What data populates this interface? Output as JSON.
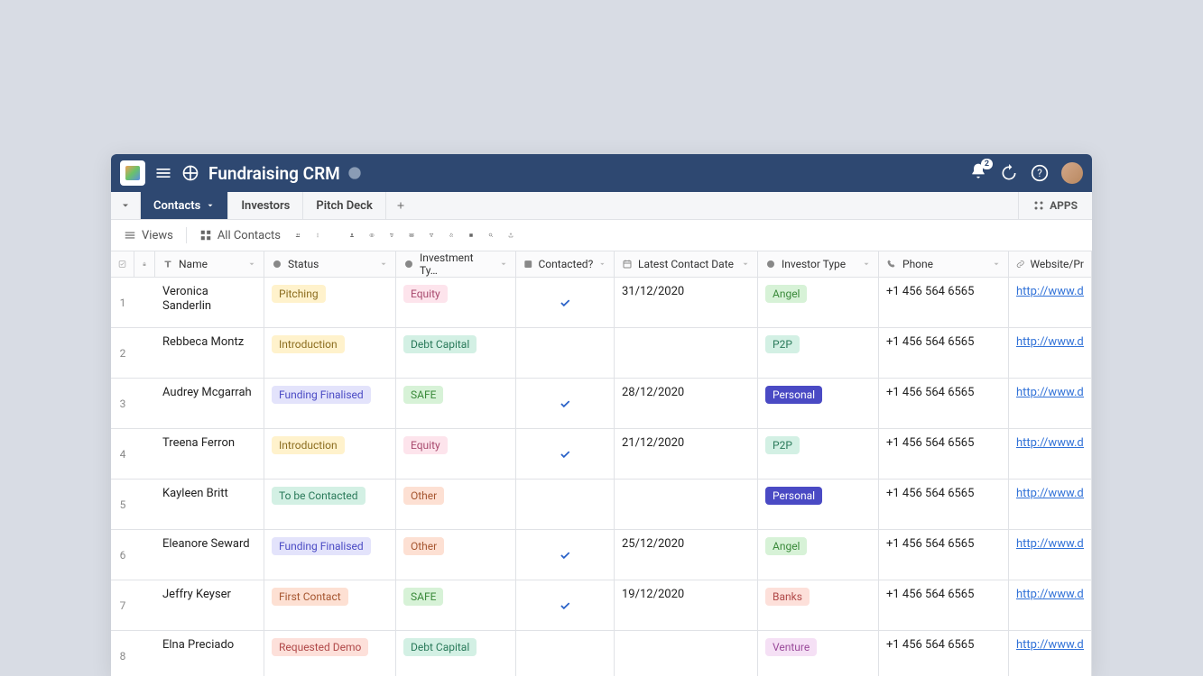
{
  "header": {
    "title": "Fundraising CRM",
    "bell_badge": "2"
  },
  "tabs": [
    {
      "label": "Contacts",
      "active": true,
      "has_dropdown": true
    },
    {
      "label": "Investors",
      "active": false
    },
    {
      "label": "Pitch Deck",
      "active": false
    }
  ],
  "apps_label": "APPS",
  "toolbar": {
    "views_label": "Views",
    "current_view": "All Contacts"
  },
  "columns": {
    "name": "Name",
    "status": "Status",
    "investment_type": "Investment Ty…",
    "contacted": "Contacted?",
    "latest_contact_date": "Latest Contact Date",
    "investor_type": "Investor Type",
    "phone": "Phone",
    "website": "Website/Pr"
  },
  "status_colors": {
    "Pitching": {
      "bg": "#fff2cc",
      "fg": "#8b6d1f"
    },
    "Introduction": {
      "bg": "#fff2cc",
      "fg": "#8b6d1f"
    },
    "Funding Finalised": {
      "bg": "#e3e3fb",
      "fg": "#4a4ac4"
    },
    "To be Contacted": {
      "bg": "#d3f0e4",
      "fg": "#2a7a5a"
    },
    "First Contact": {
      "bg": "#fde0d3",
      "fg": "#a65630"
    },
    "Requested Demo": {
      "bg": "#fde0da",
      "fg": "#b04848"
    }
  },
  "invtype_colors": {
    "Equity": {
      "bg": "#fde4ec",
      "fg": "#a84a6e"
    },
    "Debt Capital": {
      "bg": "#d3f0e4",
      "fg": "#2a7a5a"
    },
    "SAFE": {
      "bg": "#d7f2d7",
      "fg": "#3a8a3a"
    },
    "Other": {
      "bg": "#fde0d3",
      "fg": "#a65630"
    }
  },
  "investor_colors": {
    "Angel": {
      "bg": "#d7f2d7",
      "fg": "#3a8a3a"
    },
    "P2P": {
      "bg": "#d3f0e4",
      "fg": "#2a7a5a"
    },
    "Personal": {
      "bg": "#4a4ac4",
      "fg": "#ffffff"
    },
    "Banks": {
      "bg": "#fde0da",
      "fg": "#b04848"
    },
    "Venture": {
      "bg": "#f5e0f5",
      "fg": "#9a4a9a"
    }
  },
  "rows": [
    {
      "idx": "1",
      "name": "Veronica Sanderlin",
      "status": "Pitching",
      "inv_type": "Equity",
      "contacted": true,
      "date": "31/12/2020",
      "investor": "Angel",
      "phone": "+1 456 564 6565",
      "web": "http://www.don"
    },
    {
      "idx": "2",
      "name": "Rebbeca Montz",
      "status": "Introduction",
      "inv_type": "Debt Capital",
      "contacted": false,
      "date": "",
      "investor": "P2P",
      "phone": "+1 456 564 6565",
      "web": "http://www.don"
    },
    {
      "idx": "3",
      "name": "Audrey Mcgarrah",
      "status": "Funding Finalised",
      "inv_type": "SAFE",
      "contacted": true,
      "date": "28/12/2020",
      "investor": "Personal",
      "phone": "+1 456 564 6565",
      "web": "http://www.don"
    },
    {
      "idx": "4",
      "name": "Treena Ferron",
      "status": "Introduction",
      "inv_type": "Equity",
      "contacted": true,
      "date": "21/12/2020",
      "investor": "P2P",
      "phone": "+1 456 564 6565",
      "web": "http://www.don"
    },
    {
      "idx": "5",
      "name": "Kayleen Britt",
      "status": "To be Contacted",
      "inv_type": "Other",
      "contacted": false,
      "date": "",
      "investor": "Personal",
      "phone": "+1 456 564 6565",
      "web": "http://www.don"
    },
    {
      "idx": "6",
      "name": "Eleanore Seward",
      "status": "Funding Finalised",
      "inv_type": "Other",
      "contacted": true,
      "date": "25/12/2020",
      "investor": "Angel",
      "phone": "+1 456 564 6565",
      "web": "http://www.don"
    },
    {
      "idx": "7",
      "name": "Jeffry Keyser",
      "status": "First Contact",
      "inv_type": "SAFE",
      "contacted": true,
      "date": "19/12/2020",
      "investor": "Banks",
      "phone": "+1 456 564 6565",
      "web": "http://www.don"
    },
    {
      "idx": "8",
      "name": "Elna Preciado",
      "status": "Requested Demo",
      "inv_type": "Debt Capital",
      "contacted": false,
      "date": "",
      "investor": "Venture",
      "phone": "+1 456 564 6565",
      "web": "http://www.don"
    }
  ]
}
